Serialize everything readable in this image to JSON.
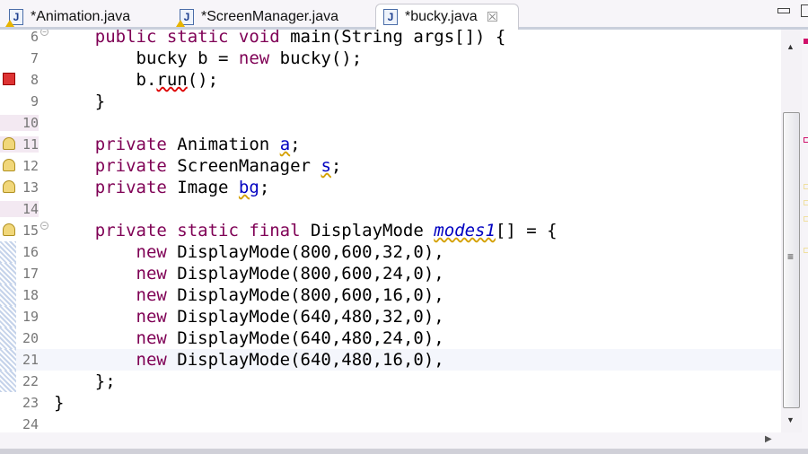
{
  "tabs": [
    {
      "label": "*Animation.java",
      "icon": "java-file-warning-icon",
      "active": false
    },
    {
      "label": "*ScreenManager.java",
      "icon": "java-file-warning-icon",
      "active": false
    },
    {
      "label": "*bucky.java",
      "icon": "java-file-icon",
      "active": true,
      "close": "☒"
    }
  ],
  "editor": {
    "current_line": 21,
    "lines": [
      {
        "n": "6",
        "html": "    <span class='kw'>public static void</span> main(String args[]) {",
        "fold": true
      },
      {
        "n": "7",
        "html": "        bucky b = <span class='kw'>new</span> bucky();"
      },
      {
        "n": "8",
        "html": "        b.<span class='sqr'>run</span>();",
        "marker": "error"
      },
      {
        "n": "9",
        "html": "    }"
      },
      {
        "n": "10",
        "html": "",
        "hl": true
      },
      {
        "n": "11",
        "html": "    <span class='kw'>private</span> Animation <span class='fld sq'>a</span>;",
        "marker": "warning",
        "hl": true
      },
      {
        "n": "12",
        "html": "    <span class='kw'>private</span> ScreenManager <span class='fld sq'>s</span>;",
        "marker": "warning"
      },
      {
        "n": "13",
        "html": "    <span class='kw'>private</span> Image <span class='fld sq'>bg</span>;",
        "marker": "warning"
      },
      {
        "n": "14",
        "html": "",
        "hl": true
      },
      {
        "n": "15",
        "html": "    <span class='kw'>private static final</span> DisplayMode <span class='it sq'>modes1</span>[] = {",
        "marker": "warning",
        "fold": true
      },
      {
        "n": "16",
        "html": "        <span class='kw'>new</span> DisplayMode(800,600,32,0),",
        "diff": true
      },
      {
        "n": "17",
        "html": "        <span class='kw'>new</span> DisplayMode(800,600,24,0),",
        "diff": true
      },
      {
        "n": "18",
        "html": "        <span class='kw'>new</span> DisplayMode(800,600,16,0),",
        "diff": true
      },
      {
        "n": "19",
        "html": "        <span class='kw'>new</span> DisplayMode(640,480,32,0),",
        "diff": true
      },
      {
        "n": "20",
        "html": "        <span class='kw'>new</span> DisplayMode(640,480,24,0),",
        "diff": true
      },
      {
        "n": "21",
        "html": "        <span class='kw'>new</span> DisplayMode(640,480,16,0),",
        "diff": true
      },
      {
        "n": "22",
        "html": "    };",
        "diff": true
      },
      {
        "n": "23",
        "html": "}"
      },
      {
        "n": "24",
        "html": ""
      }
    ]
  },
  "colors": {
    "keyword": "#7f0055",
    "field": "#0000c0",
    "error": "#d33333",
    "warning": "#f1d77a"
  }
}
